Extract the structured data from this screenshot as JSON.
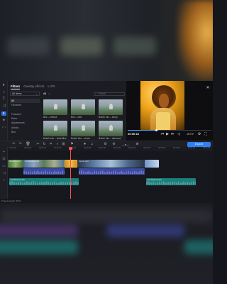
{
  "colors": {
    "accent": "#2f7ff5",
    "playhead": "#ff4d5e",
    "audio_blue": "#3d4ba6",
    "audio_teal": "#1d7f7b"
  },
  "sidebar": {
    "icons": [
      "import-icon",
      "pin-icon",
      "titles-icon",
      "transitions-icon",
      "filters-icon",
      "stickers-icon",
      "more-icon"
    ]
  },
  "panel": {
    "tabs": [
      {
        "label": "Filters",
        "active": true
      },
      {
        "label": "Overlay effects",
        "active": false
      },
      {
        "label": "LUTs",
        "active": false
      }
    ],
    "category_select": "All items",
    "categories": [
      {
        "label": "All",
        "selected": true
      },
      {
        "label": "Favorites",
        "selected": false
      },
      {
        "label": "",
        "selected": false
      },
      {
        "label": "Featured",
        "selected": false
      },
      {
        "label": "Retro",
        "selected": false
      },
      {
        "label": "Adjustments",
        "selected": false
      },
      {
        "label": "Artistic",
        "selected": false
      },
      {
        "label": "Blur",
        "selected": false
      }
    ],
    "filter_header": "All",
    "search_placeholder": "Search",
    "thumbnails": [
      {
        "label": "Blur – intense"
      },
      {
        "label": "Blur – mild"
      },
      {
        "label": "Bokeh blur – bump"
      },
      {
        "label": "Bokeh blur – butterflies"
      },
      {
        "label": "Bokeh blur – clover"
      },
      {
        "label": "Bokeh blur – diamond"
      }
    ]
  },
  "preview": {
    "time": "00:00:16",
    "progress": 0.34,
    "zoom": "16:9 ▾",
    "controls": [
      "skip-back-icon",
      "play-icon",
      "skip-forward-icon",
      "volume-icon",
      "settings-icon",
      "fullscreen-icon"
    ]
  },
  "toolbar": {
    "tools": [
      "undo-icon",
      "redo-icon",
      "delete-icon",
      "cut-icon",
      "rotate-icon",
      "crop-icon",
      "color-icon",
      "stabilize-icon",
      "marker-icon",
      "record-icon",
      "audio-icon",
      "clip-properties-icon",
      "zoom-out-icon",
      "zoom-slider-icon",
      "zoom-in-icon"
    ],
    "export_label": "Export"
  },
  "ruler": {
    "ticks": [
      "00:00:00",
      "00:00:05",
      "00:00:10",
      "00:00:15",
      "00:00:20",
      "00:00:25",
      "00:00:30",
      "00:00:35",
      "00:00:40",
      "00:00:45",
      "00:00:50",
      "00:00:55",
      "00:01:00",
      "00:01:05"
    ]
  },
  "timeline": {
    "video_clips": [
      {
        "label": "Bamboo.mp4"
      },
      {
        "label": "Sunflowers.mp4"
      },
      {
        "label": ""
      },
      {
        "label": "Sprint.mp4"
      }
    ],
    "audio_clips": [
      {
        "label": "Enchanted.mp3"
      },
      {
        "label": "Enchanted.mp3"
      }
    ]
  },
  "status": {
    "project_length": "Project length: 00:53"
  }
}
